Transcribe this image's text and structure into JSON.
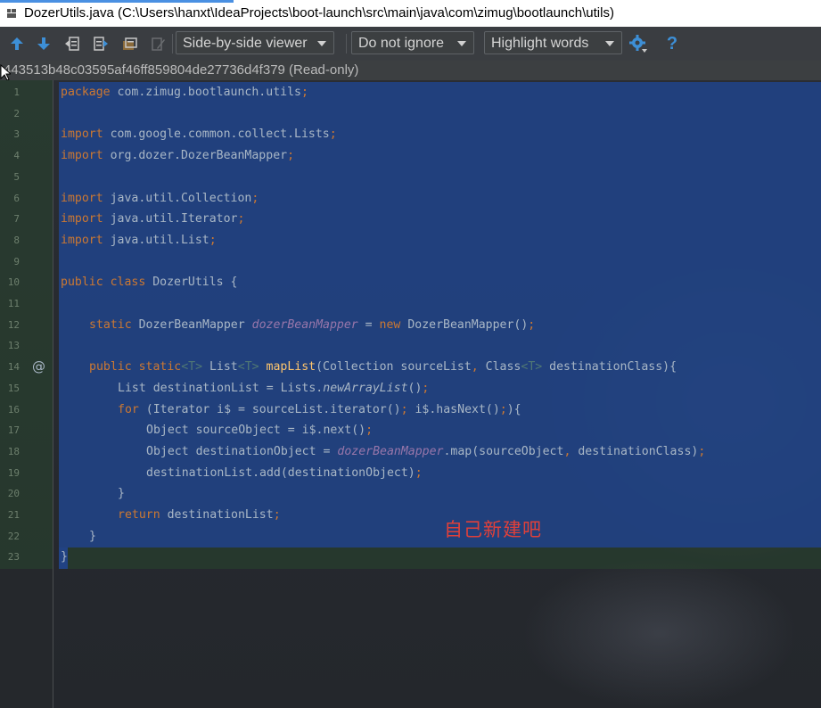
{
  "window": {
    "title": "DozerUtils.java (C:\\Users\\hanxt\\IdeaProjects\\boot-launch\\src\\main\\java\\com\\zimug\\bootlaunch\\utils)"
  },
  "toolbar": {
    "viewer_mode": "Side-by-side viewer",
    "whitespace_mode": "Do not ignore",
    "highlight_mode": "Highlight words",
    "icons": [
      "arrow-up-icon",
      "arrow-down-icon",
      "jump-to-left-icon",
      "jump-to-right-icon",
      "apply-changes-icon",
      "edit-icon",
      "settings-icon",
      "help-icon"
    ],
    "help_label": "?"
  },
  "revision": {
    "label": "443513b48c03595af46ff859804de27736d4f379 (Read-only)"
  },
  "editor": {
    "gutter_marker": "@",
    "annotation": "自己新建吧",
    "line_numbers": [
      "1",
      "2",
      "3",
      "4",
      "5",
      "6",
      "7",
      "8",
      "9",
      "10",
      "11",
      "12",
      "13",
      "14",
      "15",
      "16",
      "17",
      "18",
      "19",
      "20",
      "21",
      "22",
      "23"
    ],
    "lines": {
      "l1": {
        "kw": "package",
        "rest": " com.zimug.bootlaunch.utils",
        "end": ";"
      },
      "l3": {
        "kw": "import",
        "rest": " com.google.common.collect.Lists",
        "end": ";"
      },
      "l4": {
        "kw": "import",
        "rest": " org.dozer.DozerBeanMapper",
        "end": ";"
      },
      "l6": {
        "kw": "import",
        "rest": " java.util.Collection",
        "end": ";"
      },
      "l7": {
        "kw": "import",
        "rest": " java.util.Iterator",
        "end": ";"
      },
      "l8": {
        "kw": "import",
        "rest": " java.util.List",
        "end": ";"
      },
      "l10": {
        "kw": "public class",
        "rest": " DozerUtils {"
      },
      "l12": {
        "kw": "static",
        "type": " DozerBeanMapper ",
        "field": "dozerBeanMapper",
        "eq": " = ",
        "kw2": "new",
        "rest": " DozerBeanMapper()",
        "end": ";"
      },
      "l14": {
        "kw": "public static",
        "tp": "<T>",
        "t1": " List",
        "tp2": "<T>",
        "fn": " mapList",
        "args": "(Collection sourceList",
        "comma": ",",
        "args2": " Class",
        "tp3": "<T>",
        "args3": " destinationClass){"
      },
      "l15": {
        "pre": "List destinationList = Lists.",
        "st": "newArrayList",
        "post": "()",
        "end": ";"
      },
      "l16": {
        "kw": "for",
        "a": " (Iterator i$ = sourceList.iterator()",
        "s1": ";",
        "b": " i$.hasNext()",
        "s2": ";",
        "c": "){"
      },
      "l17": {
        "pre": "Object sourceObject = i$.next()",
        "end": ";"
      },
      "l18": {
        "pre": "Object destinationObject = ",
        "field": "dozerBeanMapper",
        "post": ".map(sourceObject",
        "comma": ",",
        "post2": " destinationClass)",
        "end": ";"
      },
      "l19": {
        "pre": "destinationList.add(destinationObject)",
        "end": ";"
      },
      "l20": {
        "pre": "}"
      },
      "l21": {
        "kw": "return",
        "rest": " destinationList",
        "end": ";"
      },
      "l22": {
        "pre": "}"
      },
      "l23": {
        "pre": "}"
      }
    }
  }
}
